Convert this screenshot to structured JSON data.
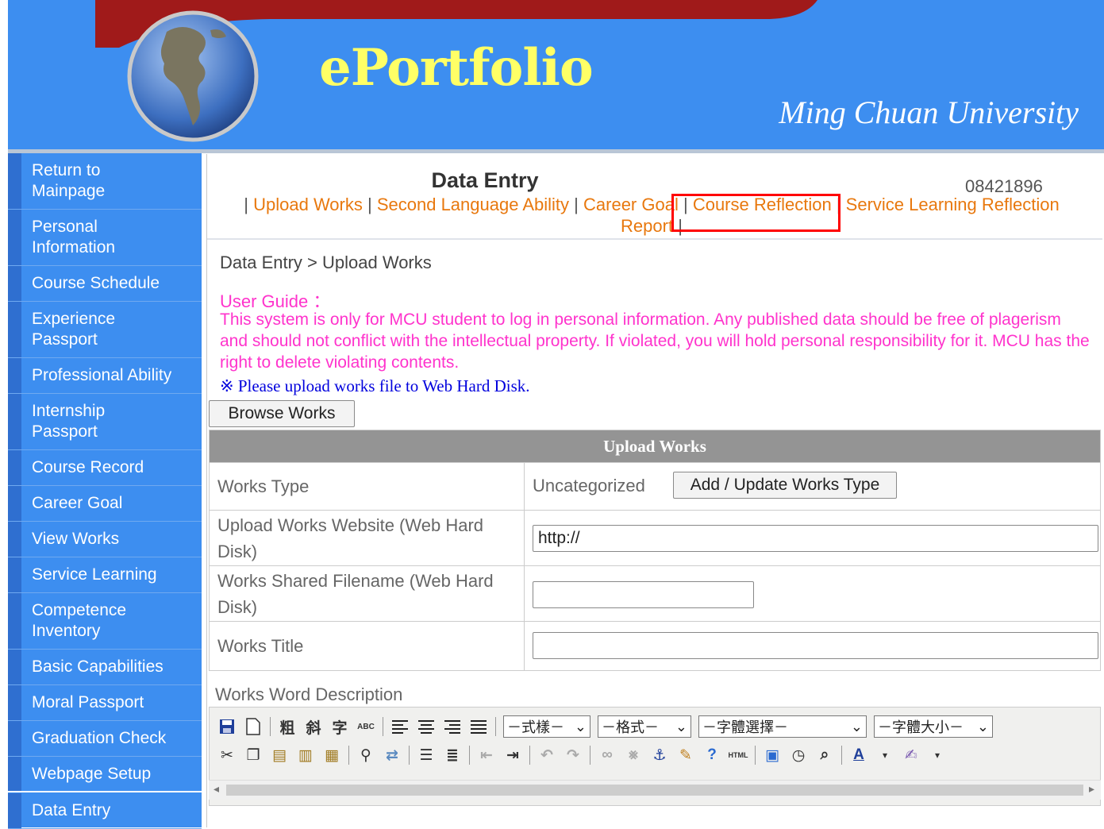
{
  "banner": {
    "title": "ePortfolio",
    "university": "Ming Chuan University"
  },
  "sidebar": {
    "items": [
      {
        "label": "Return to Mainpage"
      },
      {
        "label": "Personal Information"
      },
      {
        "label": "Course Schedule"
      },
      {
        "label": "Experience Passport"
      },
      {
        "label": "Professional Ability"
      },
      {
        "label": "Internship Passport"
      },
      {
        "label": "Course Record"
      },
      {
        "label": "Career Goal"
      },
      {
        "label": "View Works"
      },
      {
        "label": "Service Learning"
      },
      {
        "label": "Competence Inventory"
      },
      {
        "label": "Basic Capabilities"
      },
      {
        "label": "Moral Passport"
      },
      {
        "label": "Graduation Check"
      },
      {
        "label": "Webpage Setup"
      },
      {
        "label": "Data Entry"
      }
    ]
  },
  "header": {
    "heading": "Data Entry",
    "student_id": "08421896",
    "separator": "|",
    "links": [
      "Upload Works",
      "Second Language Ability",
      "Career Goal",
      "Course Reflection",
      "Service Learning Reflection Report"
    ]
  },
  "main": {
    "breadcrumb": "Data Entry > Upload Works",
    "guide_title": "User Guide ：",
    "guide_text": "This system is only for MCU student to log in personal information. Any published data should be free of plagerism and should not conflict with the intellectual property. If violated, you will hold personal responsibility for it. MCU has the right to delete violating contents.",
    "upload_note": "※ Please upload works file to Web Hard Disk.",
    "browse_button": "Browse Works"
  },
  "form": {
    "caption": "Upload Works",
    "works_type_label": "Works Type",
    "works_type_value": "Uncategorized",
    "works_type_button": "Add / Update Works Type",
    "website_label": "Upload Works Website (Web Hard Disk)",
    "website_value": "http://",
    "filename_label": "Works Shared Filename (Web Hard Disk)",
    "filename_value": "",
    "title_label": "Works Title",
    "title_value": "",
    "description_label": "Works Word Description"
  },
  "editor": {
    "style_select": "－式樣－",
    "format_select": "－格式－",
    "font_select": "－字體選擇－",
    "size_select": "－字體大小－",
    "bold_glyph": "粗",
    "italic_glyph": "斜",
    "underline_glyph": "字",
    "spell_glyph": "ABC",
    "html_glyph": "HTML"
  }
}
